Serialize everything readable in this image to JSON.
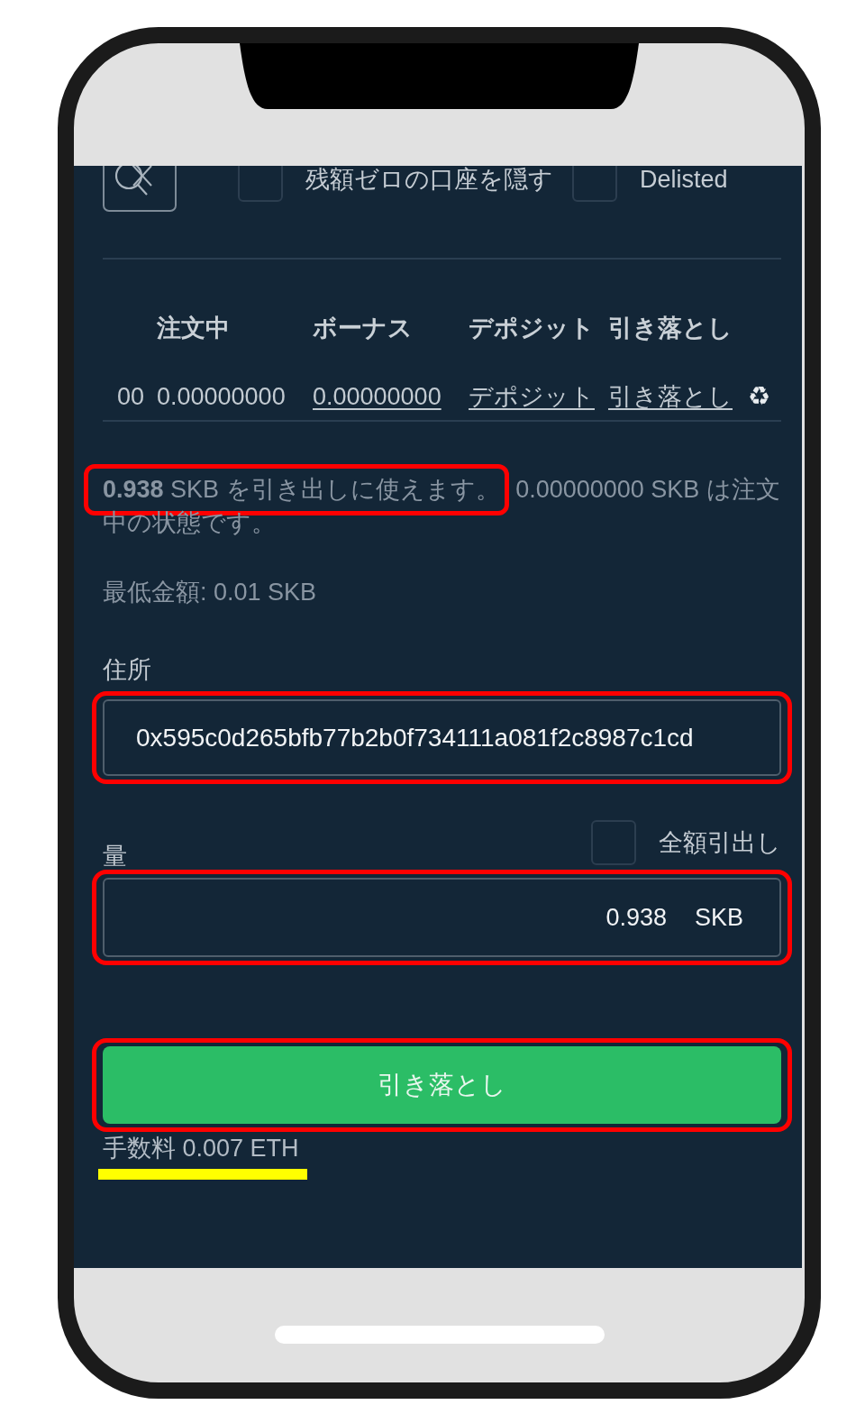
{
  "filters": [
    {
      "label": "残額ゼロの口座を隠す",
      "checked": false
    },
    {
      "label": "Delisted",
      "checked": false
    }
  ],
  "balances": {
    "columns": [
      "注文中",
      "ボーナス",
      "デポジット",
      "引き落とし"
    ],
    "cells": [
      {
        "kind": "value",
        "text": "00"
      },
      {
        "kind": "value",
        "text": "0.00000000"
      },
      {
        "kind": "link",
        "text": "0.00000000"
      },
      {
        "kind": "link",
        "text": "デポジット"
      },
      {
        "kind": "link",
        "text": "引き落とし"
      },
      {
        "kind": "icon",
        "text": "♻"
      }
    ]
  },
  "balance_note": [
    {
      "text": "**0.938** SKB を引き出しに使えます。",
      "highlighted": true
    },
    {
      "text": "0.00000000 SKB は注文中の状態です。",
      "highlighted": false
    }
  ],
  "minimum": "最低金額: 0.01 SKB",
  "address": {
    "label": "住所",
    "value": "0x595c0d265bfb77b2b0f734111a081f2c8987c1cd",
    "highlighted": true
  },
  "amount": {
    "label": "量",
    "withdraw_all": {
      "label": "全額引出し",
      "checked": false
    },
    "value": "0.938",
    "unit": "SKB",
    "highlighted": true
  },
  "withdraw_button": {
    "label": "引き落とし",
    "highlighted": true
  },
  "fee": {
    "text": "手数料 0.007 ETH",
    "underlined": true
  }
}
